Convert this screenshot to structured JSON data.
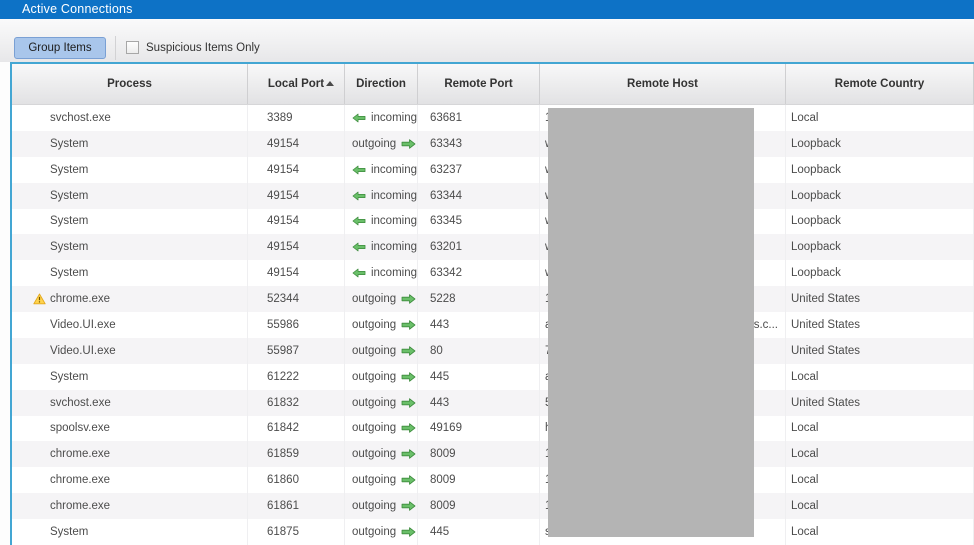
{
  "title_bar": {
    "title": "Active Connections"
  },
  "toolbar": {
    "group_items_button": "Group Items",
    "suspicious_checkbox_label": "Suspicious Items Only",
    "suspicious_checked": false
  },
  "table": {
    "columns": [
      "Process",
      "Local Port",
      "Direction",
      "Remote Port",
      "Remote Host",
      "Remote Country"
    ],
    "sort": {
      "column": "Local Port",
      "direction": "ascending"
    },
    "rows": [
      {
        "process": "svchost.exe",
        "warning": false,
        "local_port": "3389",
        "direction": "incoming",
        "remote_port": "63681",
        "host_fragment_left": "1",
        "host_fragment_right": "",
        "remote_country": "Local"
      },
      {
        "process": "System",
        "warning": false,
        "local_port": "49154",
        "direction": "outgoing",
        "remote_port": "63343",
        "host_fragment_left": "w",
        "host_fragment_right": "",
        "remote_country": "Loopback"
      },
      {
        "process": "System",
        "warning": false,
        "local_port": "49154",
        "direction": "incoming",
        "remote_port": "63237",
        "host_fragment_left": "w",
        "host_fragment_right": "",
        "remote_country": "Loopback"
      },
      {
        "process": "System",
        "warning": false,
        "local_port": "49154",
        "direction": "incoming",
        "remote_port": "63344",
        "host_fragment_left": "w",
        "host_fragment_right": "",
        "remote_country": "Loopback"
      },
      {
        "process": "System",
        "warning": false,
        "local_port": "49154",
        "direction": "incoming",
        "remote_port": "63345",
        "host_fragment_left": "w",
        "host_fragment_right": "",
        "remote_country": "Loopback"
      },
      {
        "process": "System",
        "warning": false,
        "local_port": "49154",
        "direction": "incoming",
        "remote_port": "63201",
        "host_fragment_left": "w",
        "host_fragment_right": "",
        "remote_country": "Loopback"
      },
      {
        "process": "System",
        "warning": false,
        "local_port": "49154",
        "direction": "incoming",
        "remote_port": "63342",
        "host_fragment_left": "w",
        "host_fragment_right": "",
        "remote_country": "Loopback"
      },
      {
        "process": "chrome.exe",
        "warning": true,
        "local_port": "52344",
        "direction": "outgoing",
        "remote_port": "5228",
        "host_fragment_left": "1",
        "host_fragment_right": "",
        "remote_country": "United States"
      },
      {
        "process": "Video.UI.exe",
        "warning": false,
        "local_port": "55986",
        "direction": "outgoing",
        "remote_port": "443",
        "host_fragment_left": "a",
        "host_fragment_right": "es.c...",
        "remote_country": "United States"
      },
      {
        "process": "Video.UI.exe",
        "warning": false,
        "local_port": "55987",
        "direction": "outgoing",
        "remote_port": "80",
        "host_fragment_left": "7",
        "host_fragment_right": "",
        "remote_country": "United States"
      },
      {
        "process": "System",
        "warning": false,
        "local_port": "61222",
        "direction": "outgoing",
        "remote_port": "445",
        "host_fragment_left": "a",
        "host_fragment_right": "",
        "remote_country": "Local"
      },
      {
        "process": "svchost.exe",
        "warning": false,
        "local_port": "61832",
        "direction": "outgoing",
        "remote_port": "443",
        "host_fragment_left": "5",
        "host_fragment_right": "",
        "remote_country": "United States"
      },
      {
        "process": "spoolsv.exe",
        "warning": false,
        "local_port": "61842",
        "direction": "outgoing",
        "remote_port": "49169",
        "host_fragment_left": "h",
        "host_fragment_right": "",
        "remote_country": "Local"
      },
      {
        "process": "chrome.exe",
        "warning": false,
        "local_port": "61859",
        "direction": "outgoing",
        "remote_port": "8009",
        "host_fragment_left": "1",
        "host_fragment_right": "",
        "remote_country": "Local"
      },
      {
        "process": "chrome.exe",
        "warning": false,
        "local_port": "61860",
        "direction": "outgoing",
        "remote_port": "8009",
        "host_fragment_left": "1",
        "host_fragment_right": "",
        "remote_country": "Local"
      },
      {
        "process": "chrome.exe",
        "warning": false,
        "local_port": "61861",
        "direction": "outgoing",
        "remote_port": "8009",
        "host_fragment_left": "1",
        "host_fragment_right": "",
        "remote_country": "Local"
      },
      {
        "process": "System",
        "warning": false,
        "local_port": "61875",
        "direction": "outgoing",
        "remote_port": "445",
        "host_fragment_left": "s",
        "host_fragment_right": "",
        "remote_country": "Local"
      }
    ]
  },
  "colors": {
    "titlebar_bg": "#0d72c6",
    "table_accent_border": "#43a6d3",
    "row_stripe": "#f5f4f6",
    "direction_arrow_green": "#5cb85c",
    "warning_yellow": "#ffd34d",
    "redaction_gray": "#b4b4b4",
    "button_bg": "#a9c6eb"
  }
}
